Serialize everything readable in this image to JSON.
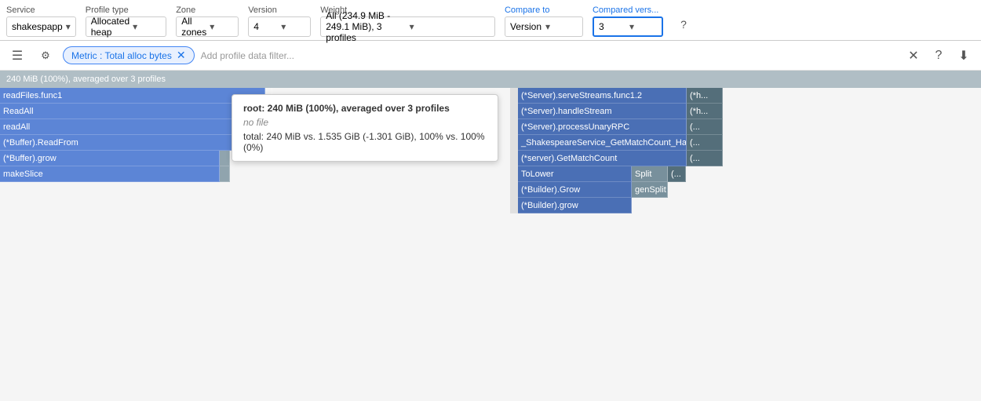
{
  "toolbar": {
    "service_label": "Service",
    "service_value": "shakespapp",
    "profile_type_label": "Profile type",
    "profile_type_value": "Allocated heap",
    "zone_label": "Zone",
    "zone_value": "All zones",
    "version_label": "Version",
    "version_value": "4",
    "weight_label": "Weight",
    "weight_value": "All (234.9 MiB - 249.1 MiB), 3 profiles",
    "compare_to_label": "Compare to",
    "compare_to_value": "Version",
    "compared_version_label": "Compared vers...",
    "compared_version_value": "3"
  },
  "filter_bar": {
    "filter_chip_label": "Metric : Total alloc bytes",
    "filter_add_placeholder": "Add profile data filter..."
  },
  "flamegraph": {
    "summary": "240 MiB (100%), averaged over 3 profiles",
    "tooltip": {
      "title": "root: 240 MiB (100%), averaged over 3 profiles",
      "file": "no file",
      "total": "total: 240 MiB vs. 1.535 GiB (-1.301 GiB), 100% vs. 100% (0%)"
    },
    "rows": [
      {
        "left_cells": [
          {
            "label": "readFiles.func1",
            "style": "blue",
            "width_pct": 52
          },
          {
            "label": "",
            "style": "empty",
            "width_pct": 0
          }
        ],
        "right_cells": [
          {
            "label": "(*Server).serveStreams.func1.2",
            "style": "blue-dark",
            "width_pct": 37
          },
          {
            "label": "(*h...",
            "style": "gray-dark",
            "width_pct": 8
          }
        ]
      },
      {
        "left_cells": [
          {
            "label": "ReadAll",
            "style": "blue",
            "width_pct": 52
          }
        ],
        "right_cells": [
          {
            "label": "(*Server).handleStream",
            "style": "blue-dark",
            "width_pct": 37
          },
          {
            "label": "(*h...",
            "style": "gray-dark",
            "width_pct": 8
          }
        ]
      },
      {
        "left_cells": [
          {
            "label": "readAll",
            "style": "blue",
            "width_pct": 52
          }
        ],
        "right_cells": [
          {
            "label": "(*Server).processUnaryRPC",
            "style": "blue-dark",
            "width_pct": 37
          },
          {
            "label": "(...",
            "style": "gray-dark",
            "width_pct": 8
          }
        ]
      },
      {
        "left_cells": [
          {
            "label": "(*Buffer).ReadFrom",
            "style": "blue",
            "width_pct": 52
          }
        ],
        "right_cells": [
          {
            "label": "_ShakespeareService_GetMatchCount_Handler",
            "style": "blue-dark",
            "width_pct": 37
          },
          {
            "label": "(...",
            "style": "gray-dark",
            "width_pct": 8
          }
        ]
      },
      {
        "left_cells": [
          {
            "label": "(*Buffer).grow",
            "style": "blue",
            "width_pct": 43
          },
          {
            "label": "",
            "style": "vbar",
            "width_pct": 2
          }
        ],
        "right_cells": [
          {
            "label": "(*server).GetMatchCount",
            "style": "blue-dark",
            "width_pct": 37
          },
          {
            "label": "(...",
            "style": "gray-dark",
            "width_pct": 8
          }
        ]
      },
      {
        "left_cells": [
          {
            "label": "makeSlice",
            "style": "blue",
            "width_pct": 43
          },
          {
            "label": "",
            "style": "vbar",
            "width_pct": 2
          }
        ],
        "right_cells": [
          {
            "label": "ToLower",
            "style": "blue-dark",
            "width_pct": 25
          },
          {
            "label": "Split",
            "style": "gray",
            "width_pct": 8
          },
          {
            "label": "(...",
            "style": "gray-dark",
            "width_pct": 4
          }
        ]
      },
      {
        "left_cells": [],
        "right_cells": [
          {
            "label": "(*Builder).Grow",
            "style": "blue-dark",
            "width_pct": 25
          },
          {
            "label": "genSplit",
            "style": "gray",
            "width_pct": 8
          }
        ]
      },
      {
        "left_cells": [],
        "right_cells": [
          {
            "label": "(*Builder).grow",
            "style": "blue-dark",
            "width_pct": 25
          }
        ]
      }
    ]
  }
}
